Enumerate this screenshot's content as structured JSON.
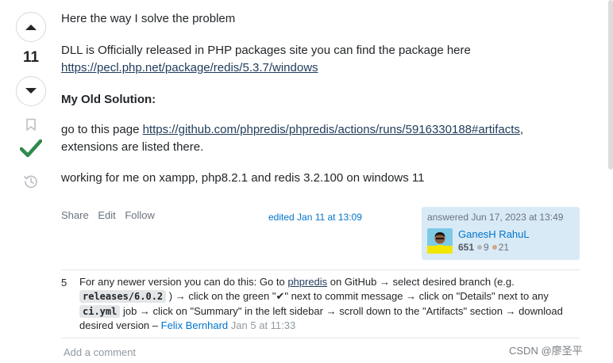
{
  "vote": {
    "score": "11"
  },
  "post": {
    "line1": "Here the way I solve the problem",
    "line2": "DLL is Officially released in PHP packages site you can find the package here",
    "link1": "https://pecl.php.net/package/redis/5.3.7/windows",
    "heading": "My Old Solution:",
    "line3_pre": "go to this page ",
    "link2": "https://github.com/phpredis/phpredis/actions/runs/5916330188#artifacts",
    "line3_post": ",",
    "line4": "extensions are listed there.",
    "line5": "working for me on xampp, php8.2.1 and redis 3.2.100 on windows 11"
  },
  "menu": {
    "share": "Share",
    "edit": "Edit",
    "follow": "Follow"
  },
  "edited": "edited Jan 11 at 13:09",
  "user_card": {
    "action": "answered Jun 17, 2023 at 13:49",
    "name": "GanesH RahuL",
    "reputation": "651",
    "silver": "9",
    "bronze": "21"
  },
  "comment": {
    "score": "5",
    "l1_pre": "For any newer version you can do this: Go to ",
    "l1_link": "phpredis",
    "l1_post": " on GitHub → select desired branch (e.g.",
    "l2_code": "releases/6.0.2",
    "l2_text": ") → click on the green \"✔\" next to commit message → click on \"Details\" next to any",
    "l3_code": "ci.yml",
    "l3_text": " job → click on \"Summary\" in the left sidebar → scroll down to the \"Artifacts\" section → download",
    "l4_text": "desired version – ",
    "user": "Felix Bernhard",
    "date": "Jan 5 at 11:33"
  },
  "add_comment": "Add a comment",
  "watermark": "CSDN @廖圣平",
  "colors": {
    "accept_green": "#2f8a4d",
    "link_blue": "#0074cc",
    "user_card_bg": "#d9eaf7"
  },
  "icons": [
    "upvote-arrow-icon",
    "downvote-arrow-icon",
    "bookmark-icon",
    "accepted-check-icon",
    "history-icon"
  ]
}
